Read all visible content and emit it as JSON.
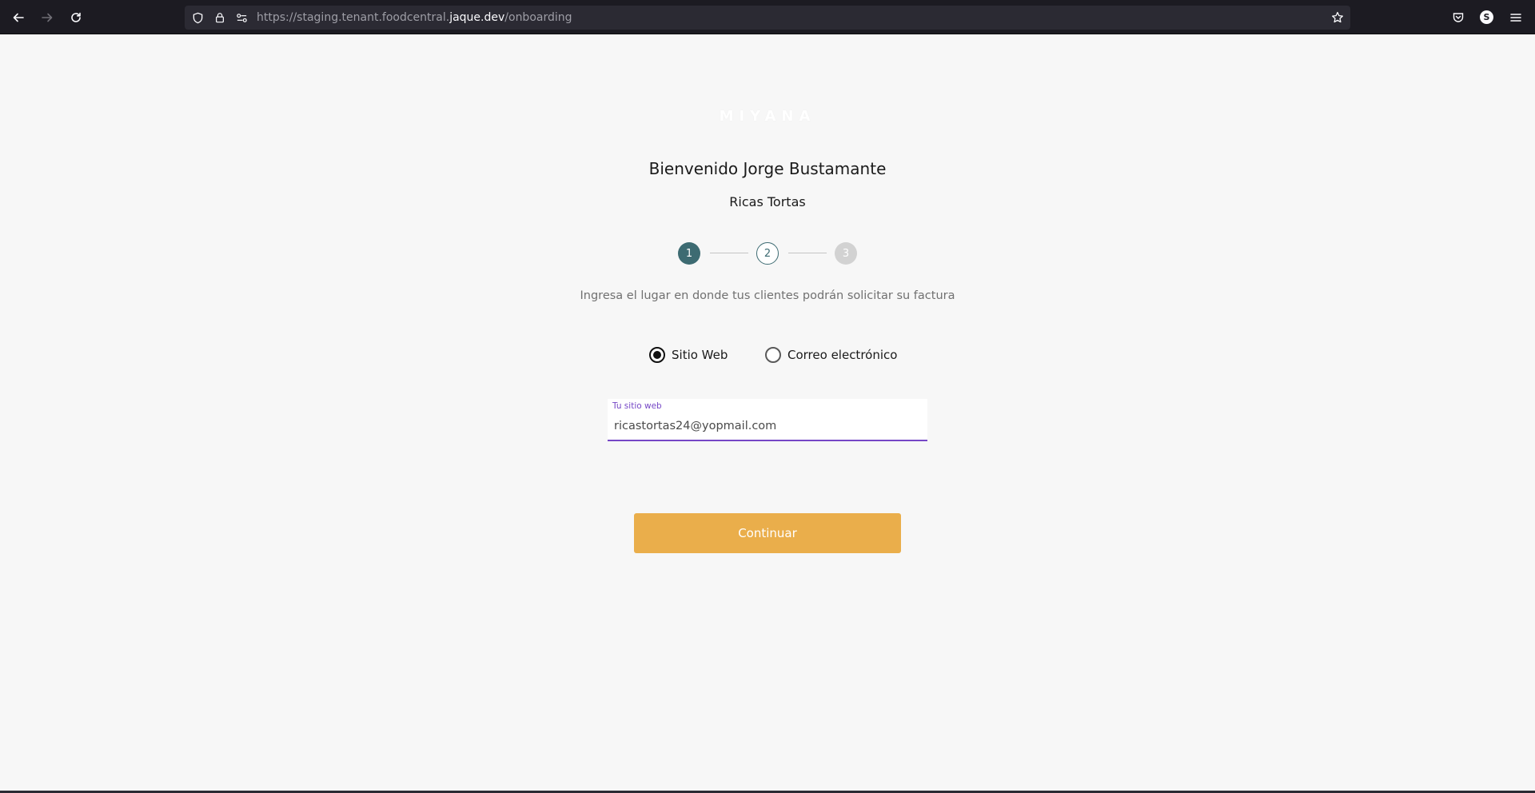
{
  "browser": {
    "url_prefix": "https://staging.tenant.foodcentral.",
    "url_host": "jaque.dev",
    "url_path": "/onboarding",
    "account_initial": "S"
  },
  "page": {
    "logo_text": "MIYANA",
    "welcome": "Bienvenido Jorge Bustamante",
    "company": "Ricas Tortas",
    "steps": [
      {
        "number": "1",
        "state": "active"
      },
      {
        "number": "2",
        "state": "next"
      },
      {
        "number": "3",
        "state": "disabled"
      }
    ],
    "instruction": "Ingresa el lugar en donde tus clientes podrán solicitar su factura",
    "options": [
      {
        "label": "Sitio Web",
        "checked": true
      },
      {
        "label": "Correo electrónico",
        "checked": false
      }
    ],
    "field": {
      "label": "Tu sitio web",
      "value": "ricastortas24@yopmail.com"
    },
    "continue_label": "Continuar"
  },
  "colors": {
    "primary": "#3d6b72",
    "accent_field": "#7547c6",
    "button": "#eaae4b",
    "background": "#f7f7f7"
  }
}
